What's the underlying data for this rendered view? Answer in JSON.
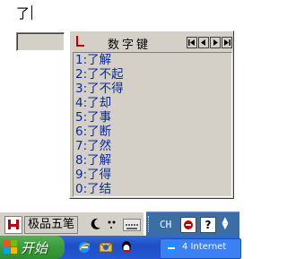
{
  "document": {
    "typed_text": "了"
  },
  "candidate_window": {
    "title": "数字键",
    "items": [
      "1:了解",
      "2:了不起",
      "3:了不得",
      "4:了却",
      "5:了事",
      "6:了断",
      "7:了然",
      "8:了解",
      "9:了得",
      "0:了结"
    ],
    "nav_icons": [
      "first-page-icon",
      "prev-page-icon",
      "next-page-icon",
      "last-page-icon"
    ],
    "text_color": "#0b2a9a"
  },
  "ime_status_bar": {
    "ime_name": "极品五笔",
    "icons": [
      "ime-logo-icon",
      "half-width-moon-icon",
      "punctuation-icon",
      "soft-keyboard-icon"
    ]
  },
  "language_bar": {
    "language": "CH",
    "icons": [
      "input-method-icon",
      "help-icon",
      "options-arrow-icon"
    ]
  },
  "taskbar": {
    "start_label": "开始",
    "task_label": "4 Internet",
    "quick_launch_icons": [
      "ie-icon",
      "outlook-icon",
      "qq-icon"
    ],
    "accent": "#2458d4"
  }
}
